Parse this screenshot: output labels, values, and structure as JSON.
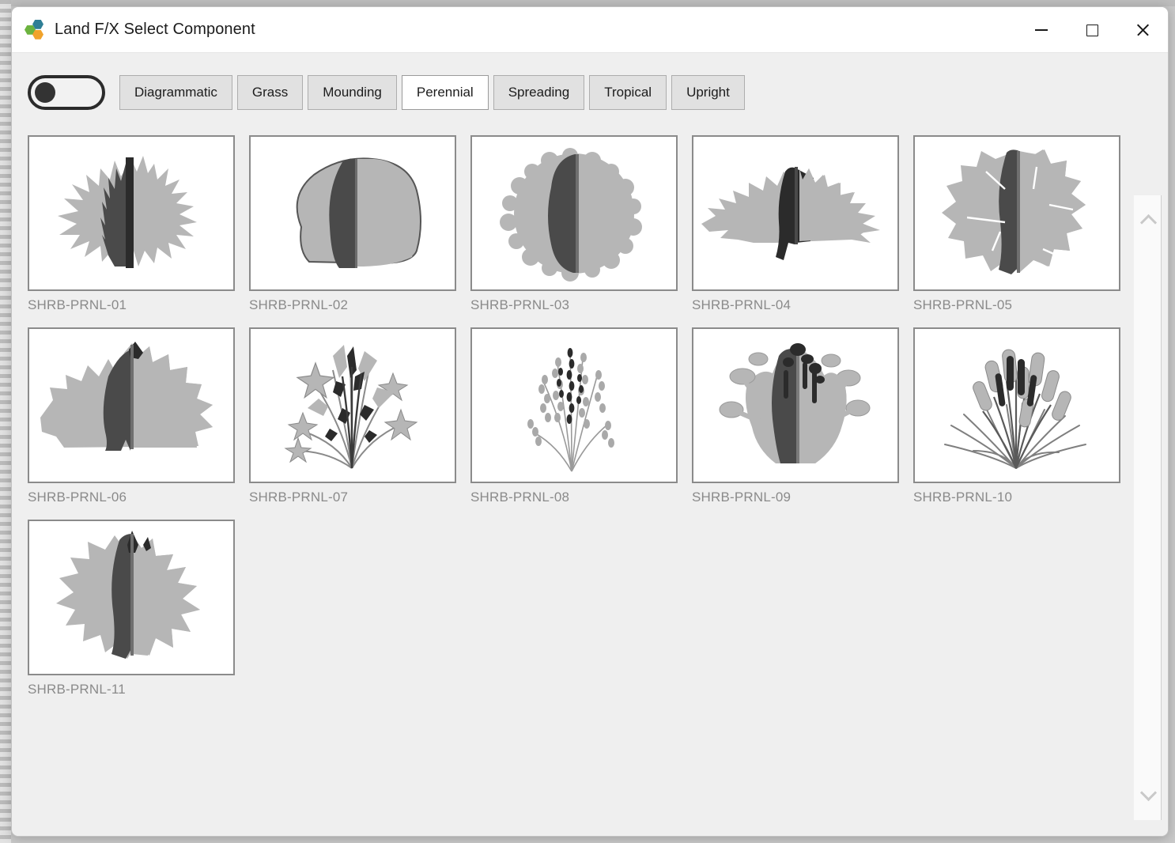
{
  "window": {
    "title": "Land F/X Select Component",
    "logo_icon": "landfx-hexagons-logo",
    "controls": {
      "minimize_icon": "minimize-icon",
      "maximize_icon": "maximize-icon",
      "close_icon": "close-icon"
    }
  },
  "toolbar": {
    "toggle": {
      "icon": "toggle-switch-icon",
      "state": "off"
    },
    "tabs": [
      {
        "label": "Diagrammatic",
        "selected": false
      },
      {
        "label": "Grass",
        "selected": false
      },
      {
        "label": "Mounding",
        "selected": false
      },
      {
        "label": "Perennial",
        "selected": true
      },
      {
        "label": "Spreading",
        "selected": false
      },
      {
        "label": "Tropical",
        "selected": false
      },
      {
        "label": "Upright",
        "selected": false
      }
    ]
  },
  "grid": {
    "items": [
      {
        "label": "SHRB-PRNL-01",
        "symbol": "spiky-fan-shrub"
      },
      {
        "label": "SHRB-PRNL-02",
        "symbol": "rounded-mound-shrub"
      },
      {
        "label": "SHRB-PRNL-03",
        "symbol": "frilly-round-shrub"
      },
      {
        "label": "SHRB-PRNL-04",
        "symbol": "wide-jagged-spreading-shrub"
      },
      {
        "label": "SHRB-PRNL-05",
        "symbol": "lobed-round-shrub"
      },
      {
        "label": "SHRB-PRNL-06",
        "symbol": "broad-leaf-clump-shrub"
      },
      {
        "label": "SHRB-PRNL-07",
        "symbol": "pinwheel-flower-spray"
      },
      {
        "label": "SHRB-PRNL-08",
        "symbol": "lavender-spike-clump"
      },
      {
        "label": "SHRB-PRNL-09",
        "symbol": "flowering-perennial-clump"
      },
      {
        "label": "SHRB-PRNL-10",
        "symbol": "grass-cattail-clump"
      },
      {
        "label": "SHRB-PRNL-11",
        "symbol": "star-lobed-shrub"
      }
    ]
  },
  "scrollbar": {
    "up_icon": "chevron-up-icon",
    "down_icon": "chevron-down-icon"
  },
  "colors": {
    "symbol_light": "#b6b6b6",
    "symbol_dark": "#4a4a4a",
    "symbol_darkest": "#2b2b2b",
    "label_text": "#8a8a8a",
    "window_body": "#efefef",
    "tab_unselected": "#e1e1e1",
    "tab_selected": "#ffffff"
  }
}
